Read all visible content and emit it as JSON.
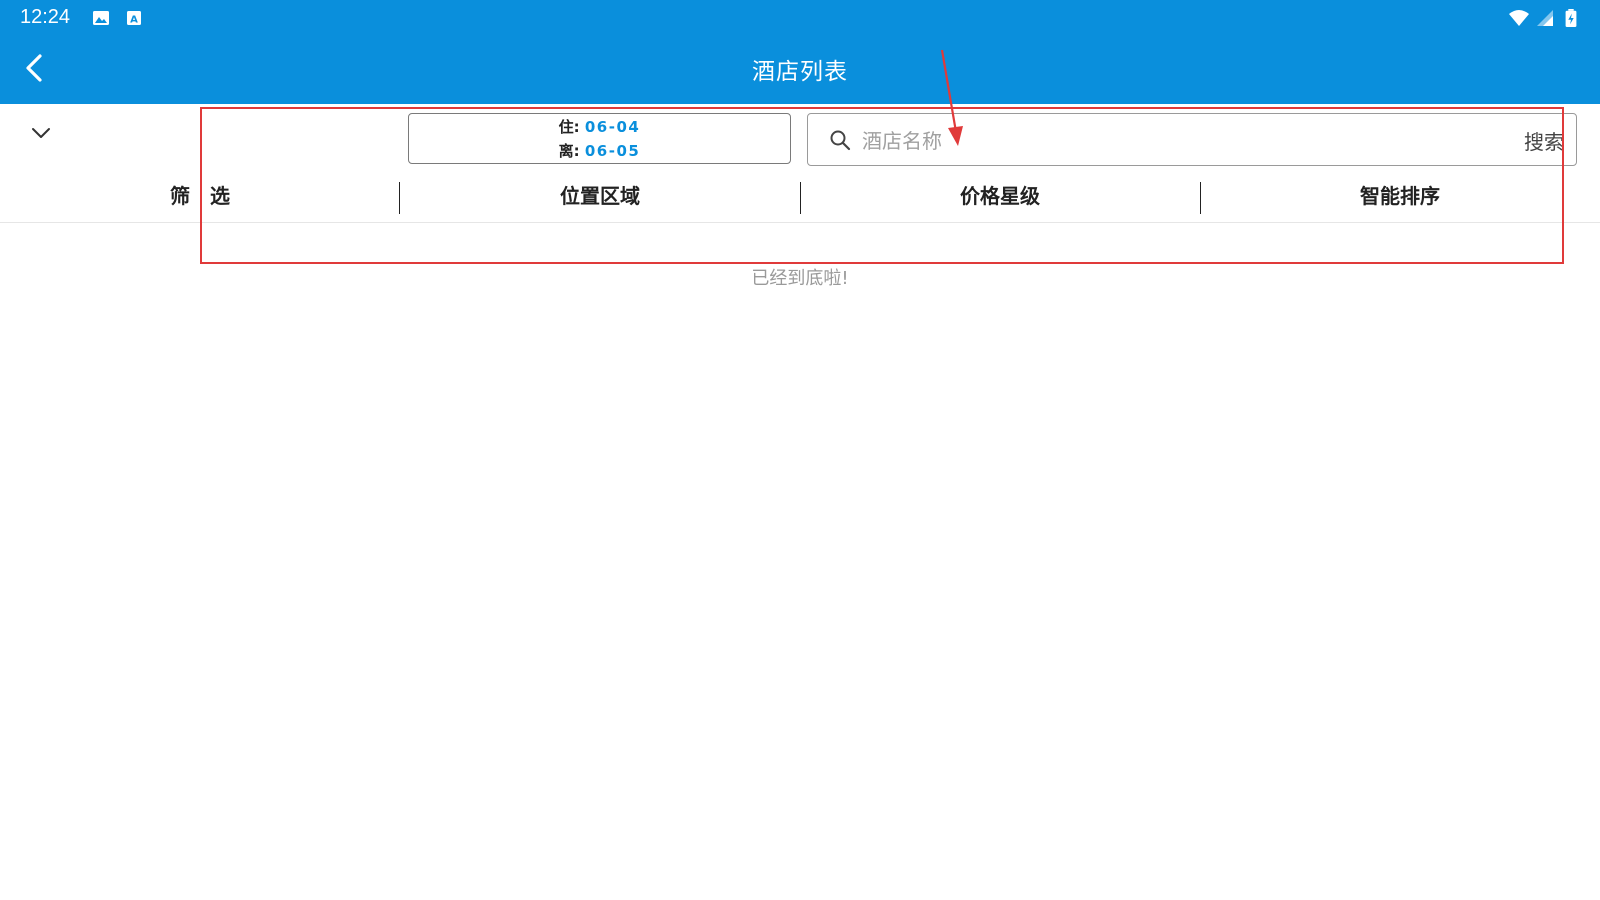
{
  "status_bar": {
    "time": "12:24"
  },
  "app_bar": {
    "title": "酒店列表"
  },
  "dates": {
    "checkin_label": "住:",
    "checkin_value": "06-04",
    "checkout_label": "离:",
    "checkout_value": "06-05"
  },
  "search": {
    "placeholder": "酒店名称",
    "button_label": "搜索"
  },
  "tabs": [
    {
      "label": "筛　选"
    },
    {
      "label": "位置区域"
    },
    {
      "label": "价格星级"
    },
    {
      "label": "智能排序"
    }
  ],
  "list": {
    "end_text": "已经到底啦!"
  },
  "colors": {
    "primary": "#0a8fdc",
    "annotation": "#e03a3a"
  }
}
